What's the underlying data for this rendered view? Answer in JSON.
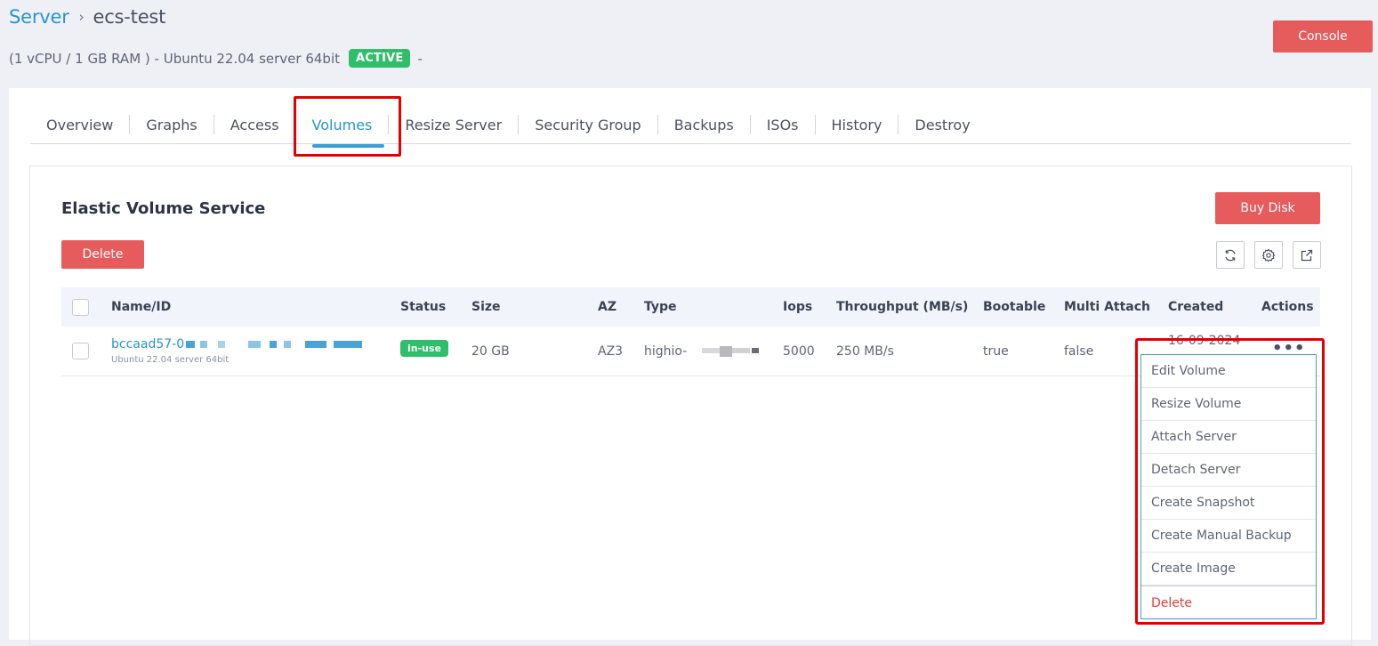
{
  "header": {
    "breadcrumb_root": "Server",
    "breadcrumb_sep": "›",
    "breadcrumb_current": "ecs-test",
    "subtitle": "(1 vCPU / 1 GB RAM ) - Ubuntu 22.04 server 64bit",
    "status_badge": "ACTIVE",
    "subtitle_trailing": "-",
    "console_label": "Console"
  },
  "tabs": [
    {
      "label": "Overview"
    },
    {
      "label": "Graphs"
    },
    {
      "label": "Access"
    },
    {
      "label": "Volumes"
    },
    {
      "label": "Resize Server"
    },
    {
      "label": "Security Group"
    },
    {
      "label": "Backups"
    },
    {
      "label": "ISOs"
    },
    {
      "label": "History"
    },
    {
      "label": "Destroy"
    }
  ],
  "panel": {
    "title": "Elastic Volume Service",
    "buy_disk_label": "Buy Disk",
    "delete_label": "Delete",
    "icons": [
      "refresh-icon",
      "gear-icon",
      "external-link-icon"
    ]
  },
  "table": {
    "columns": [
      "Name/ID",
      "Status",
      "Size",
      "AZ",
      "Type",
      "Iops",
      "Throughput (MB/s)",
      "Bootable",
      "Multi Attach",
      "Created",
      "Actions"
    ],
    "rows": [
      {
        "name": "bccaad57-0",
        "subtitle": "Ubuntu 22.04 server 64bit",
        "status": "in-use",
        "size": "20 GB",
        "az": "AZ3",
        "type": "highio-",
        "iops": "5000",
        "throughput": "250 MB/s",
        "bootable": "true",
        "multi_attach": "false",
        "created": "16-09-2024",
        "actions": "•••"
      }
    ]
  },
  "dropdown": {
    "items": [
      {
        "label": "Edit Volume"
      },
      {
        "label": "Resize Volume"
      },
      {
        "label": "Attach Server"
      },
      {
        "label": "Detach Server"
      },
      {
        "label": "Create Snapshot"
      },
      {
        "label": "Create Manual Backup"
      },
      {
        "label": "Create Image"
      },
      {
        "label": "Delete"
      }
    ]
  },
  "colors": {
    "accent": "#2795cf",
    "danger": "#e65b5b",
    "success": "#2fbe6a",
    "highlight": "#e40000"
  }
}
